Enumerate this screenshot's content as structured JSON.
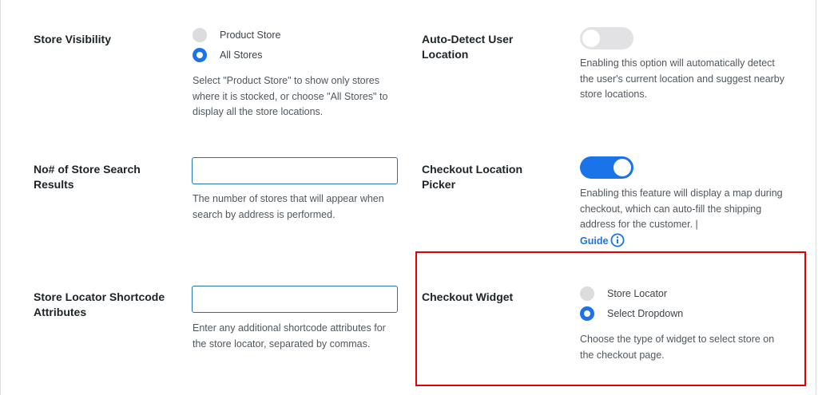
{
  "store_visibility": {
    "label": "Store Visibility",
    "options": [
      {
        "label": "Product Store",
        "selected": false
      },
      {
        "label": "All Stores",
        "selected": true
      }
    ],
    "description": "Select \"Product Store\" to show only stores where it is stocked, or choose \"All Stores\" to display all the store locations."
  },
  "auto_detect": {
    "label": "Auto-Detect User Location",
    "enabled": false,
    "description": "Enabling this option will automatically detect the user's current location and suggest nearby store locations."
  },
  "search_results": {
    "label": "No# of Store Search Results",
    "value": "",
    "description": "The number of stores that will appear when search by address is performed."
  },
  "checkout_picker": {
    "label": "Checkout Location Picker",
    "enabled": true,
    "description": "Enabling this feature will display a map during checkout, which can auto-fill the shipping address for the customer. |",
    "guide_label": "Guide"
  },
  "shortcode": {
    "label": "Store Locator Shortcode Attributes",
    "value": "",
    "description": "Enter any additional shortcode attributes for the store locator, separated by commas."
  },
  "checkout_widget": {
    "label": "Checkout Widget",
    "options": [
      {
        "label": "Store Locator",
        "selected": false
      },
      {
        "label": "Select Dropdown",
        "selected": true
      }
    ],
    "description": "Choose the type of widget to select store on the checkout page."
  },
  "colors": {
    "accent": "#1a73e8",
    "highlight": "#e00000",
    "toggle_off": "#e2e2e4",
    "radio_off": "#dcdcde"
  }
}
